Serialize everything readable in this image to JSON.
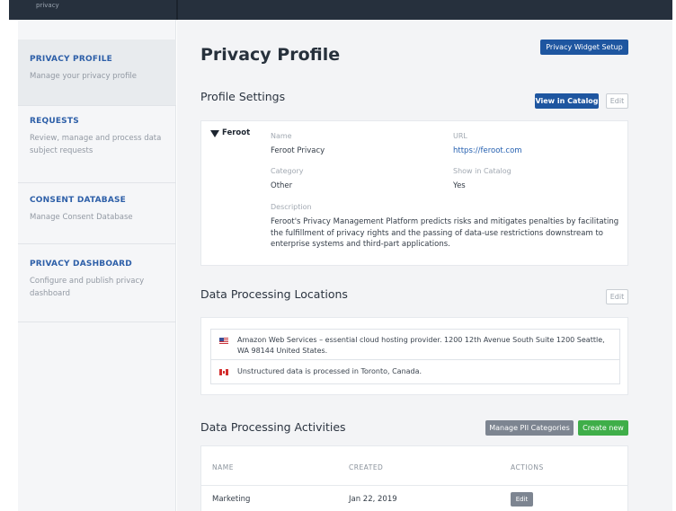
{
  "topbar": {
    "logo_text": "privacy"
  },
  "sidebar": {
    "items": [
      {
        "title": "PRIVACY PROFILE",
        "desc": "Manage your privacy profile"
      },
      {
        "title": "REQUESTS",
        "desc": "Review, manage and process data subject requests"
      },
      {
        "title": "CONSENT DATABASE",
        "desc": "Manage Consent Database"
      },
      {
        "title": "PRIVACY DASHBOARD",
        "desc": "Configure and publish privacy dashboard"
      }
    ]
  },
  "main": {
    "title": "Privacy Profile",
    "widget_button": "Privacy Widget Setup",
    "profile": {
      "section_title": "Profile Settings",
      "view_catalog": "View in Catalog",
      "edit": "Edit",
      "logo_text": "Feroot",
      "name_label": "Name",
      "name_value": "Feroot Privacy",
      "url_label": "URL",
      "url_value": "https://feroot.com",
      "category_label": "Category",
      "category_value": "Other",
      "catalog_label": "Show in Catalog",
      "catalog_value": "Yes",
      "description_label": "Description",
      "description_value": "Feroot's Privacy Management Platform predicts risks and mitigates penalties by facilitating the fulfillment of privacy rights and the passing of data-use restrictions downstream to enterprise systems and third-part applications."
    },
    "locations": {
      "section_title": "Data Processing Locations",
      "edit": "Edit",
      "rows": [
        {
          "flag": "us-flag",
          "text": "Amazon Web Services – essential cloud hosting provider. 1200 12th Avenue South Suite 1200 Seattle, WA 98144 United States."
        },
        {
          "flag": "canada-flag",
          "text": "Unstructured data is processed in Toronto, Canada."
        }
      ]
    },
    "activities": {
      "section_title": "Data Processing Activities",
      "manage_button": "Manage PII Categories",
      "create_button": "Create new",
      "columns": [
        "NAME",
        "CREATED",
        "ACTIONS"
      ],
      "rows": [
        {
          "name": "Marketing",
          "created": "Jan 22, 2019",
          "action": "Edit"
        }
      ]
    }
  },
  "colors": {
    "accent": "#1e56a0",
    "green": "#3fae49",
    "sidebar_title": "#2d5fa8"
  }
}
